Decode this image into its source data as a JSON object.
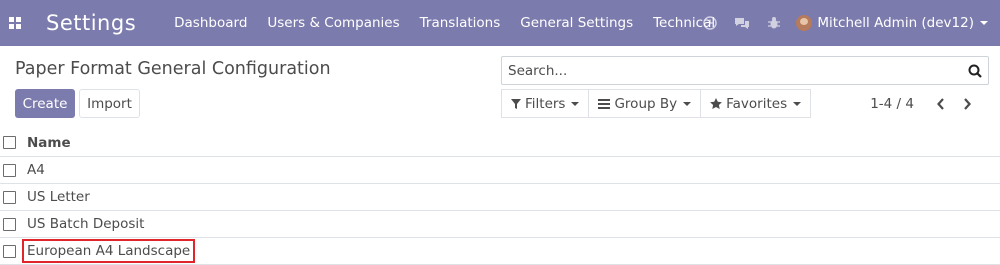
{
  "navbar": {
    "app_title": "Settings",
    "menu": [
      "Dashboard",
      "Users & Companies",
      "Translations",
      "General Settings",
      "Technical"
    ],
    "user": "Mitchell Admin (dev12)",
    "bg_color": "#7c7bad",
    "icons": [
      "apps-grid-icon",
      "clock-icon",
      "chat-icon",
      "bug-icon",
      "avatar"
    ]
  },
  "control_panel": {
    "title": "Paper Format General Configuration",
    "create_label": "Create",
    "import_label": "Import",
    "search_placeholder": "Search...",
    "filters_label": "Filters",
    "groupby_label": "Group By",
    "favorites_label": "Favorites",
    "pager": "1-4 / 4"
  },
  "table": {
    "header": "Name",
    "rows": [
      "A4",
      "US Letter",
      "US Batch Deposit",
      "European A4 Landscape"
    ],
    "highlighted_row": 3
  }
}
